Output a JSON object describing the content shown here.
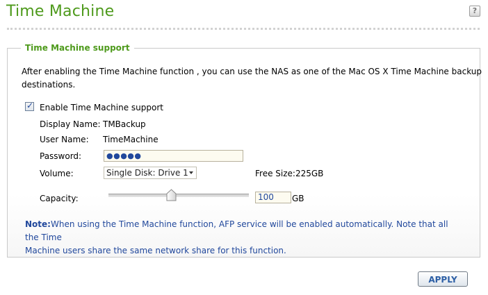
{
  "header": {
    "title": "Time Machine",
    "help_icon_text": "?"
  },
  "section": {
    "title": "Time Machine support",
    "description_line1": "After enabling the Time Machine function , you can use the NAS as one of the Mac OS X Time Machine backup",
    "description_line2": "destinations."
  },
  "form": {
    "enable_label": "Enable Time Machine support",
    "enable_checked": true,
    "display_name_label": "Display Name:",
    "display_name_value": "TMBackup",
    "user_name_label": "User Name:",
    "user_name_value": "TimeMachine",
    "password_label": "Password:",
    "password_value": "●●●●●",
    "volume_label": "Volume:",
    "volume_selected": "Single Disk: Drive 1",
    "free_size": "Free Size:225GB",
    "capacity_label": "Capacity:",
    "capacity_value": "100",
    "capacity_unit": "GB",
    "capacity_slider_fraction": 0.45
  },
  "note": {
    "label": "Note:",
    "text_line1": "When using the Time Machine function, AFP service will be enabled automatically. Note that all the Time",
    "text_line2": "Machine users share the same network share for this function."
  },
  "actions": {
    "apply_label": "APPLY"
  },
  "colors": {
    "title_green": "#4e9a1c",
    "note_blue": "#21489c",
    "apply_text": "#2d5fa5"
  }
}
